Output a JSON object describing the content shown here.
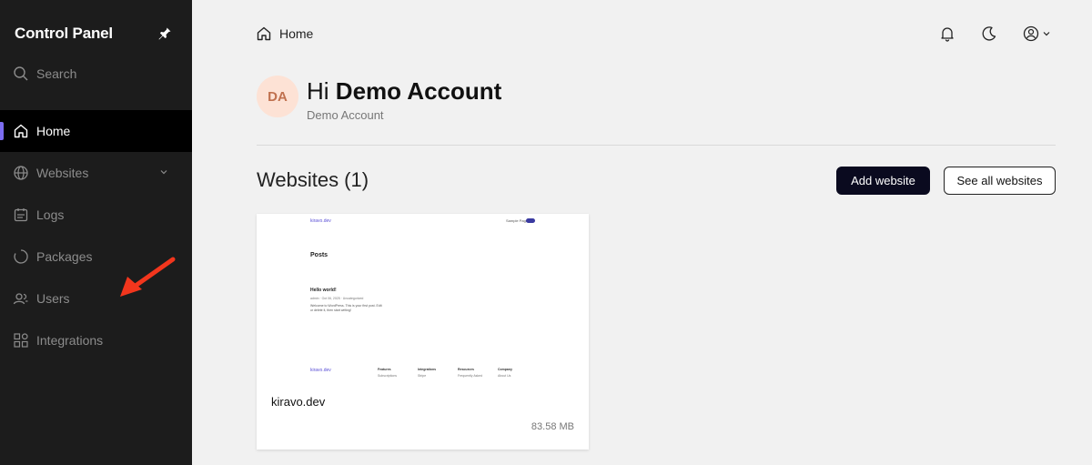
{
  "sidebar": {
    "brand": "Control Panel",
    "search_label": "Search",
    "items": [
      {
        "label": "Home",
        "icon": "home-icon",
        "active": true
      },
      {
        "label": "Websites",
        "icon": "globe-icon"
      },
      {
        "label": "Logs",
        "icon": "logs-icon"
      },
      {
        "label": "Packages",
        "icon": "packages-icon"
      },
      {
        "label": "Users",
        "icon": "users-icon"
      },
      {
        "label": "Integrations",
        "icon": "integrations-icon"
      }
    ]
  },
  "header": {
    "breadcrumb": "Home"
  },
  "greeting": {
    "avatar_initials": "DA",
    "hi": "Hi",
    "name": "Demo Account",
    "subtitle": "Demo Account"
  },
  "websites": {
    "title": "Websites (1)",
    "add_label": "Add website",
    "see_all_label": "See all websites",
    "cards": [
      {
        "name": "kiravo.dev",
        "size": "83.58 MB",
        "preview": {
          "logo": "kiravo.dev",
          "sample": "Sample Page",
          "posts": "Posts",
          "post_title": "Hello world!",
          "post_meta": "admin · Oct 06, 2025 · Uncategorized",
          "post_body": "Welcome to WordPress. This is your first post. Edit or delete it, then start writing!",
          "footer_logo": "kiravo.dev",
          "footer_cols": [
            {
              "head": "Features",
              "item": "Subscriptions"
            },
            {
              "head": "Integrations",
              "item": "Stripe"
            },
            {
              "head": "Resources",
              "item": "Frequently Asked"
            },
            {
              "head": "Company",
              "item": "About Us"
            }
          ]
        }
      }
    ]
  },
  "colors": {
    "sidebar_bg": "#1c1c1c",
    "accent": "#7c6cf0",
    "primary_button": "#0a0a1f",
    "avatar_bg": "#fde2d5",
    "annotation_arrow": "#f2361d"
  }
}
